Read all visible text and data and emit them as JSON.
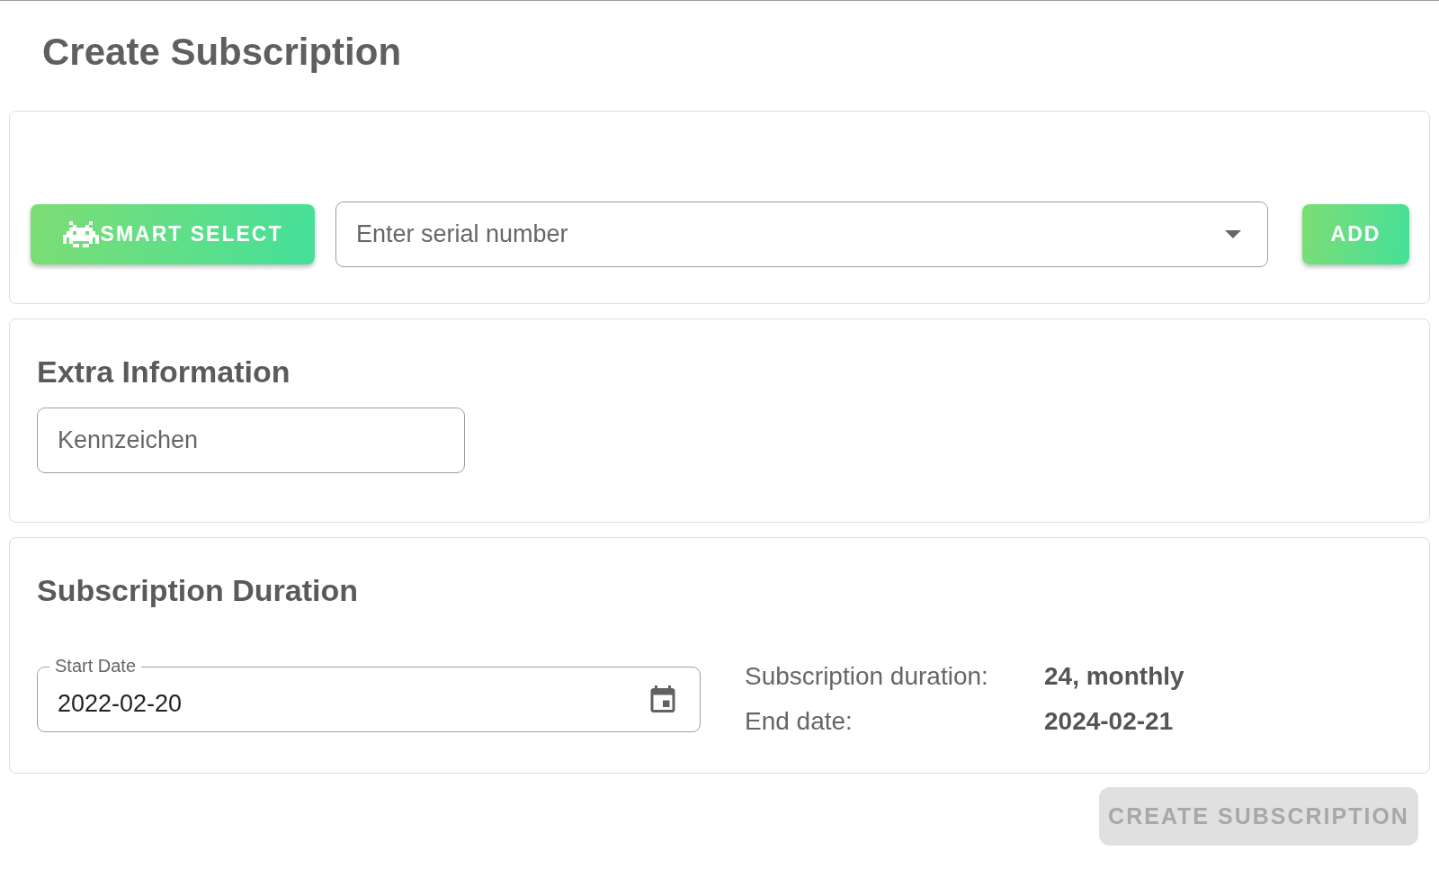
{
  "page": {
    "title": "Create Subscription"
  },
  "device_card": {
    "smart_select_button": "SMART SELECT",
    "serial_field": {
      "placeholder": "Enter serial number"
    },
    "add_button": "ADD"
  },
  "extra_information": {
    "heading": "Extra Information",
    "license_plate_field": {
      "placeholder": "Kennzeichen"
    }
  },
  "subscription_duration": {
    "heading": "Subscription Duration",
    "start_date_field": {
      "label": "Start Date",
      "value": "2022-02-20"
    },
    "details": [
      {
        "label": "Subscription duration:",
        "value": "24, monthly"
      },
      {
        "label": "End date:",
        "value": "2024-02-21"
      }
    ]
  },
  "create_button": {
    "label": "CREATE SUBSCRIPTION",
    "disabled": true
  }
}
